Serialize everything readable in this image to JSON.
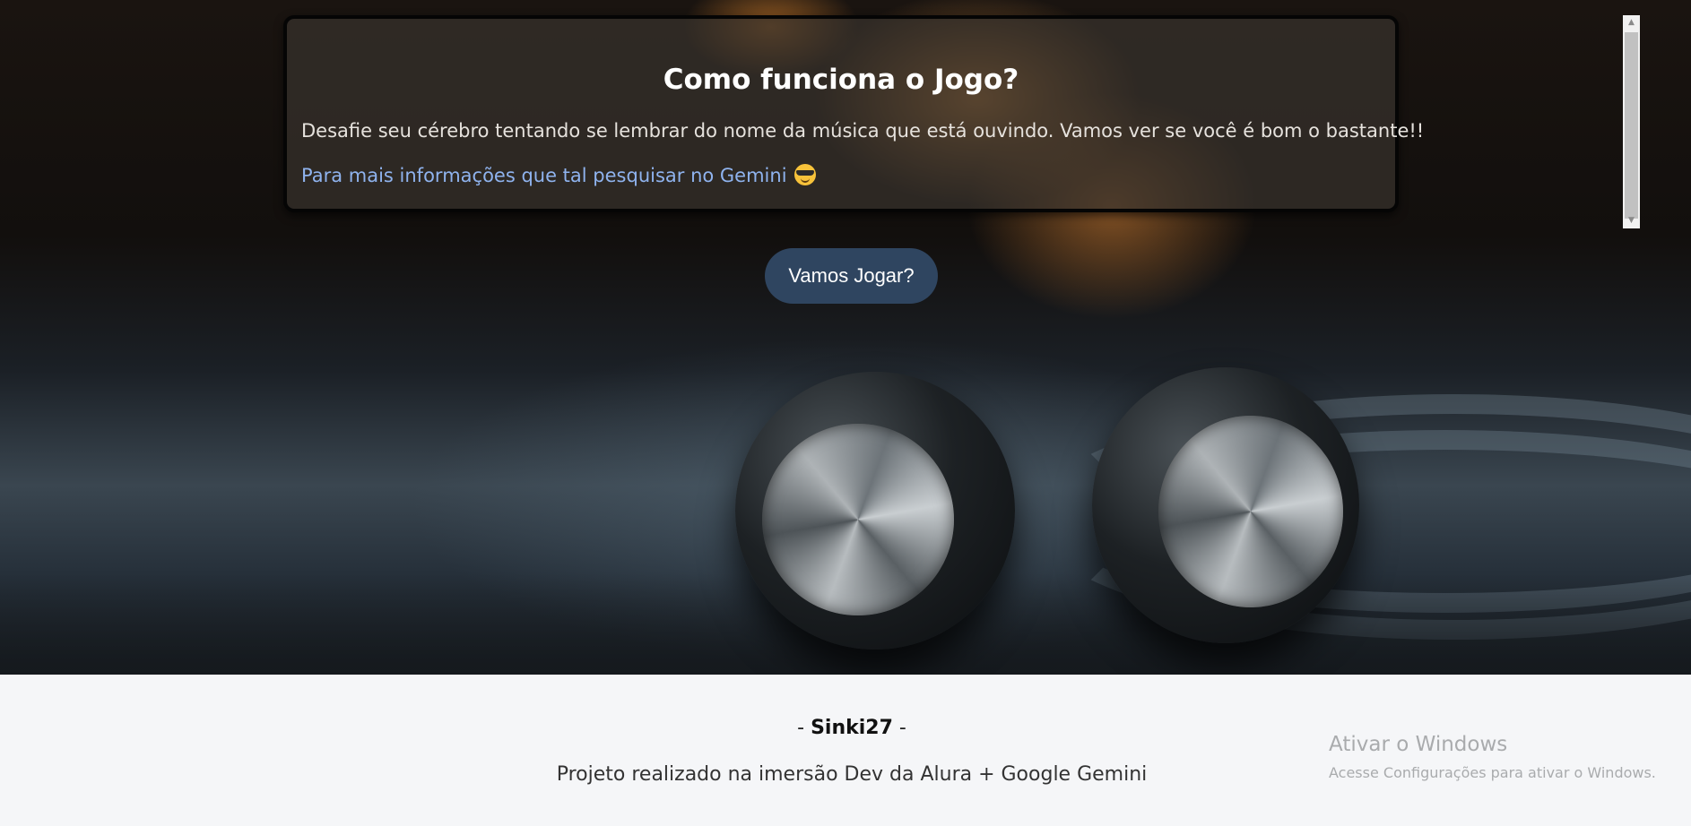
{
  "info_panel": {
    "title": "Como funciona o Jogo?",
    "description": "Desafie seu cérebro tentando se lembrar do nome da música que está ouvindo. Vamos ver se você é bom o bastante!!",
    "link_text": "Para mais informações que tal pesquisar no Gemini",
    "link_emoji": "smiling-face-with-sunglasses-icon"
  },
  "play_button": {
    "label": "Vamos Jogar?"
  },
  "footer": {
    "author_prefix": "- ",
    "author": "Sinki27",
    "author_suffix": " -",
    "credit": "Projeto realizado na imersão Dev da Alura + Google Gemini"
  },
  "windows_watermark": {
    "title": "Ativar o Windows",
    "subtitle": "Acesse Configurações para ativar o Windows."
  },
  "colors": {
    "panel_background": "#37322d",
    "link": "#8fb3ee",
    "button_background": "#2f4560",
    "footer_background": "#f5f6f8"
  }
}
